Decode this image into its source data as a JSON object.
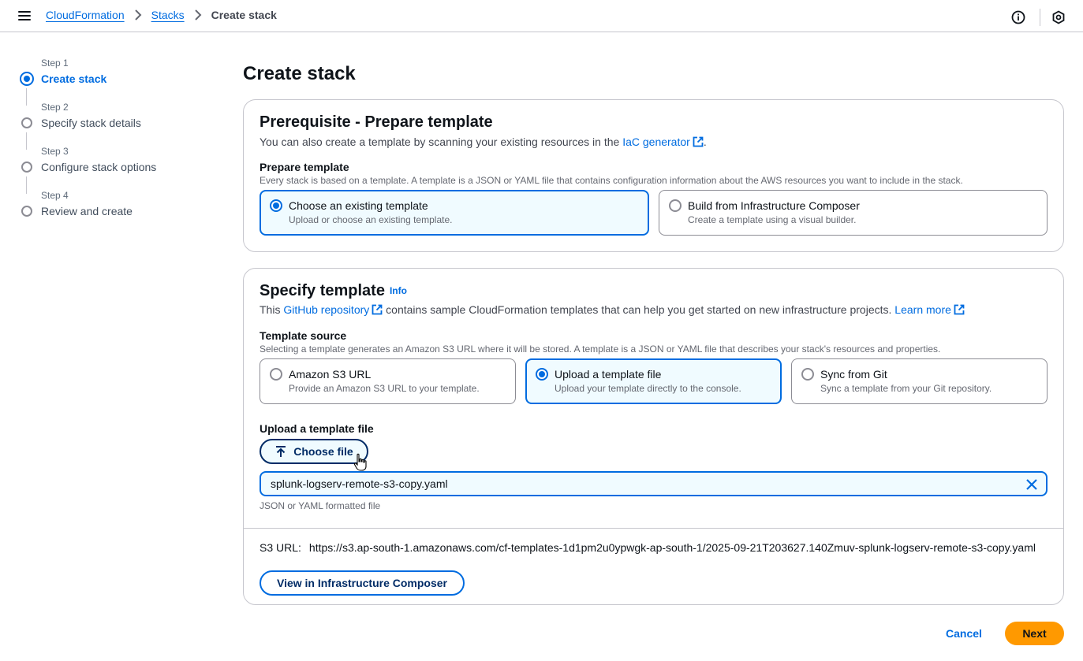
{
  "breadcrumbs": [
    {
      "label": "CloudFormation"
    },
    {
      "label": "Stacks"
    },
    {
      "label": "Create stack"
    }
  ],
  "steps": [
    {
      "num": "Step 1",
      "label": "Create stack",
      "active": true
    },
    {
      "num": "Step 2",
      "label": "Specify stack details"
    },
    {
      "num": "Step 3",
      "label": "Configure stack options"
    },
    {
      "num": "Step 4",
      "label": "Review and create"
    }
  ],
  "page_title": "Create stack",
  "prereq": {
    "title": "Prerequisite - Prepare template",
    "desc_prefix": "You can also create a template by scanning your existing resources in the",
    "desc_link": "IaC generator",
    "desc_suffix": ".",
    "field_label": "Prepare template",
    "field_desc": "Every stack is based on a template. A template is a JSON or YAML file that contains configuration information about the AWS resources you want to include in the stack.",
    "options": [
      {
        "title": "Choose an existing template",
        "desc": "Upload or choose an existing template.",
        "selected": true
      },
      {
        "title": "Build from Infrastructure Composer",
        "desc": "Create a template using a visual builder."
      }
    ]
  },
  "specify": {
    "title": "Specify template",
    "info": "Info",
    "desc_prefix": "This",
    "desc_link1": "GitHub repository",
    "desc_middle": "contains sample CloudFormation templates that can help you get started on new infrastructure projects.",
    "desc_link2": "Learn more",
    "source_label": "Template source",
    "source_desc": "Selecting a template generates an Amazon S3 URL where it will be stored. A template is a JSON or YAML file that describes your stack's resources and properties.",
    "options": [
      {
        "title": "Amazon S3 URL",
        "desc": "Provide an Amazon S3 URL to your template."
      },
      {
        "title": "Upload a template file",
        "desc": "Upload your template directly to the console.",
        "selected": true
      },
      {
        "title": "Sync from Git",
        "desc": "Sync a template from your Git repository."
      }
    ],
    "upload_label": "Upload a template file",
    "choose_file": "Choose file",
    "file_name": "splunk-logserv-remote-s3-copy.yaml",
    "file_hint": "JSON or YAML formatted file",
    "s3_label": "S3 URL:",
    "s3_value": "https://s3.ap-south-1.amazonaws.com/cf-templates-1d1pm2u0ypwgk-ap-south-1/2025-09-21T203627.140Zmuv-splunk-logserv-remote-s3-copy.yaml",
    "view_button": "View in Infrastructure Composer"
  },
  "footer": {
    "cancel": "Cancel",
    "next": "Next"
  },
  "colors": {
    "accent": "#006ce0",
    "primary_button": "#ff9900"
  }
}
